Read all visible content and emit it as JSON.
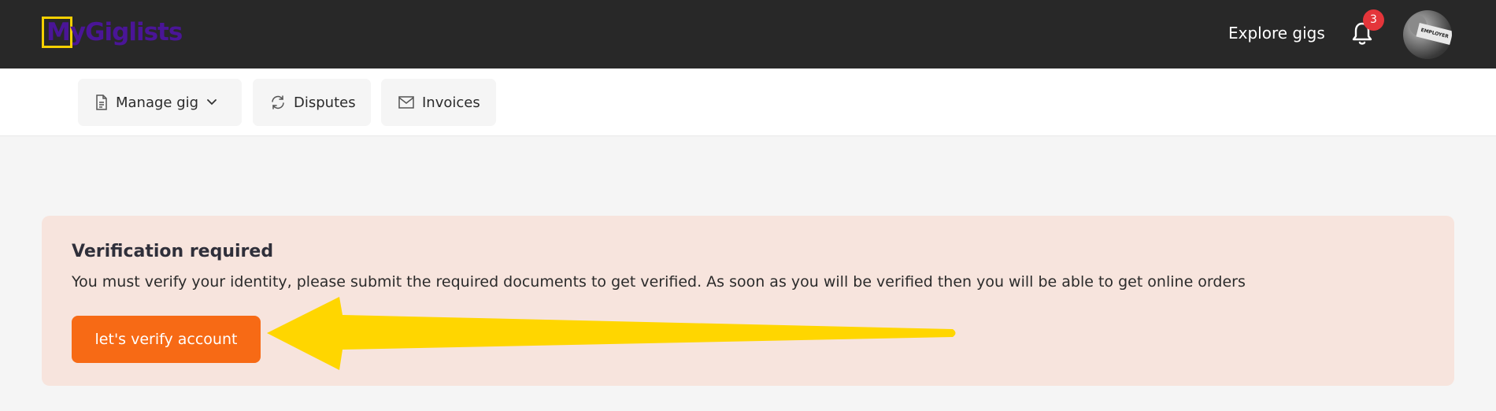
{
  "header": {
    "logo_text": "MyGiglists",
    "explore_label": "Explore gigs",
    "notification_count": "3",
    "avatar_label": "EMPLOYER"
  },
  "subnav": {
    "manage_label": "Manage gig",
    "disputes_label": "Disputes",
    "invoices_label": "Invoices"
  },
  "alert": {
    "title": "Verification required",
    "message": "You must verify your identity, please submit the required documents to get verified. As soon as you will be verified then you will be able to get online orders",
    "button_label": "let's verify account"
  },
  "colors": {
    "navbar": "#282828",
    "accent_button": "#f76a15",
    "alert_bg": "#f7e4dd",
    "arrow": "#ffd600",
    "badge": "#e4353a",
    "logo_box": "#f5d000",
    "logo_text": "#4a1597"
  }
}
